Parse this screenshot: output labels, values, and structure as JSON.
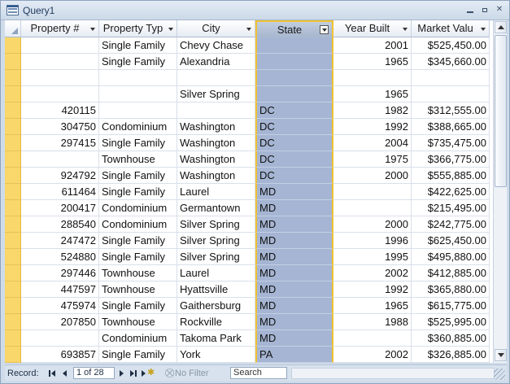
{
  "window": {
    "title": "Query1"
  },
  "columns": [
    {
      "key": "property_id",
      "label": "Property #",
      "align": "num"
    },
    {
      "key": "property_type",
      "label": "Property Typ",
      "align": "text"
    },
    {
      "key": "city",
      "label": "City",
      "align": "text"
    },
    {
      "key": "state",
      "label": "State",
      "align": "text",
      "selected": true
    },
    {
      "key": "year_built",
      "label": "Year Built",
      "align": "num"
    },
    {
      "key": "market_value",
      "label": "Market Valu",
      "align": "num"
    }
  ],
  "rows": [
    {
      "property_id": "",
      "property_type": "Single Family",
      "city": "Chevy Chase",
      "state": "",
      "year_built": "2001",
      "market_value": "$525,450.00"
    },
    {
      "property_id": "",
      "property_type": "Single Family",
      "city": "Alexandria",
      "state": "",
      "year_built": "1965",
      "market_value": "$345,660.00"
    },
    {
      "property_id": "",
      "property_type": "",
      "city": "",
      "state": "",
      "year_built": "",
      "market_value": ""
    },
    {
      "property_id": "",
      "property_type": "",
      "city": "Silver Spring",
      "state": "",
      "year_built": "1965",
      "market_value": ""
    },
    {
      "property_id": "420115",
      "property_type": "",
      "city": "",
      "state": "DC",
      "year_built": "1982",
      "market_value": "$312,555.00"
    },
    {
      "property_id": "304750",
      "property_type": "Condominium",
      "city": "Washington",
      "state": "DC",
      "year_built": "1992",
      "market_value": "$388,665.00"
    },
    {
      "property_id": "297415",
      "property_type": "Single Family",
      "city": "Washington",
      "state": "DC",
      "year_built": "2004",
      "market_value": "$735,475.00"
    },
    {
      "property_id": "",
      "property_type": "Townhouse",
      "city": "Washington",
      "state": "DC",
      "year_built": "1975",
      "market_value": "$366,775.00"
    },
    {
      "property_id": "924792",
      "property_type": "Single Family",
      "city": "Washington",
      "state": "DC",
      "year_built": "2000",
      "market_value": "$555,885.00"
    },
    {
      "property_id": "611464",
      "property_type": "Single Family",
      "city": "Laurel",
      "state": "MD",
      "year_built": "",
      "market_value": "$422,625.00"
    },
    {
      "property_id": "200417",
      "property_type": "Condominium",
      "city": "Germantown",
      "state": "MD",
      "year_built": "",
      "market_value": "$215,495.00"
    },
    {
      "property_id": "288540",
      "property_type": "Condominium",
      "city": "Silver Spring",
      "state": "MD",
      "year_built": "2000",
      "market_value": "$242,775.00"
    },
    {
      "property_id": "247472",
      "property_type": "Single Family",
      "city": "Silver Spring",
      "state": "MD",
      "year_built": "1996",
      "market_value": "$625,450.00"
    },
    {
      "property_id": "524880",
      "property_type": "Single Family",
      "city": "Silver Spring",
      "state": "MD",
      "year_built": "1995",
      "market_value": "$495,880.00"
    },
    {
      "property_id": "297446",
      "property_type": "Townhouse",
      "city": "Laurel",
      "state": "MD",
      "year_built": "2002",
      "market_value": "$412,885.00"
    },
    {
      "property_id": "447597",
      "property_type": "Townhouse",
      "city": "Hyattsville",
      "state": "MD",
      "year_built": "1992",
      "market_value": "$365,880.00"
    },
    {
      "property_id": "475974",
      "property_type": "Single Family",
      "city": "Gaithersburg",
      "state": "MD",
      "year_built": "1965",
      "market_value": "$615,775.00"
    },
    {
      "property_id": "207850",
      "property_type": "Townhouse",
      "city": "Rockville",
      "state": "MD",
      "year_built": "1988",
      "market_value": "$525,995.00"
    },
    {
      "property_id": "",
      "property_type": "Condominium",
      "city": "Takoma Park",
      "state": "MD",
      "year_built": "",
      "market_value": "$360,885.00"
    },
    {
      "property_id": "693857",
      "property_type": "Single Family",
      "city": "York",
      "state": "PA",
      "year_built": "2002",
      "market_value": "$326,885.00"
    }
  ],
  "navigation": {
    "record_label": "Record:",
    "current_record": "1 of 28",
    "filter_label": "No Filter",
    "search_placeholder": "Search"
  },
  "colors": {
    "selected_column": "#a5b5d3",
    "selection_border": "#f1c232",
    "row_selector": "#fad76a"
  }
}
